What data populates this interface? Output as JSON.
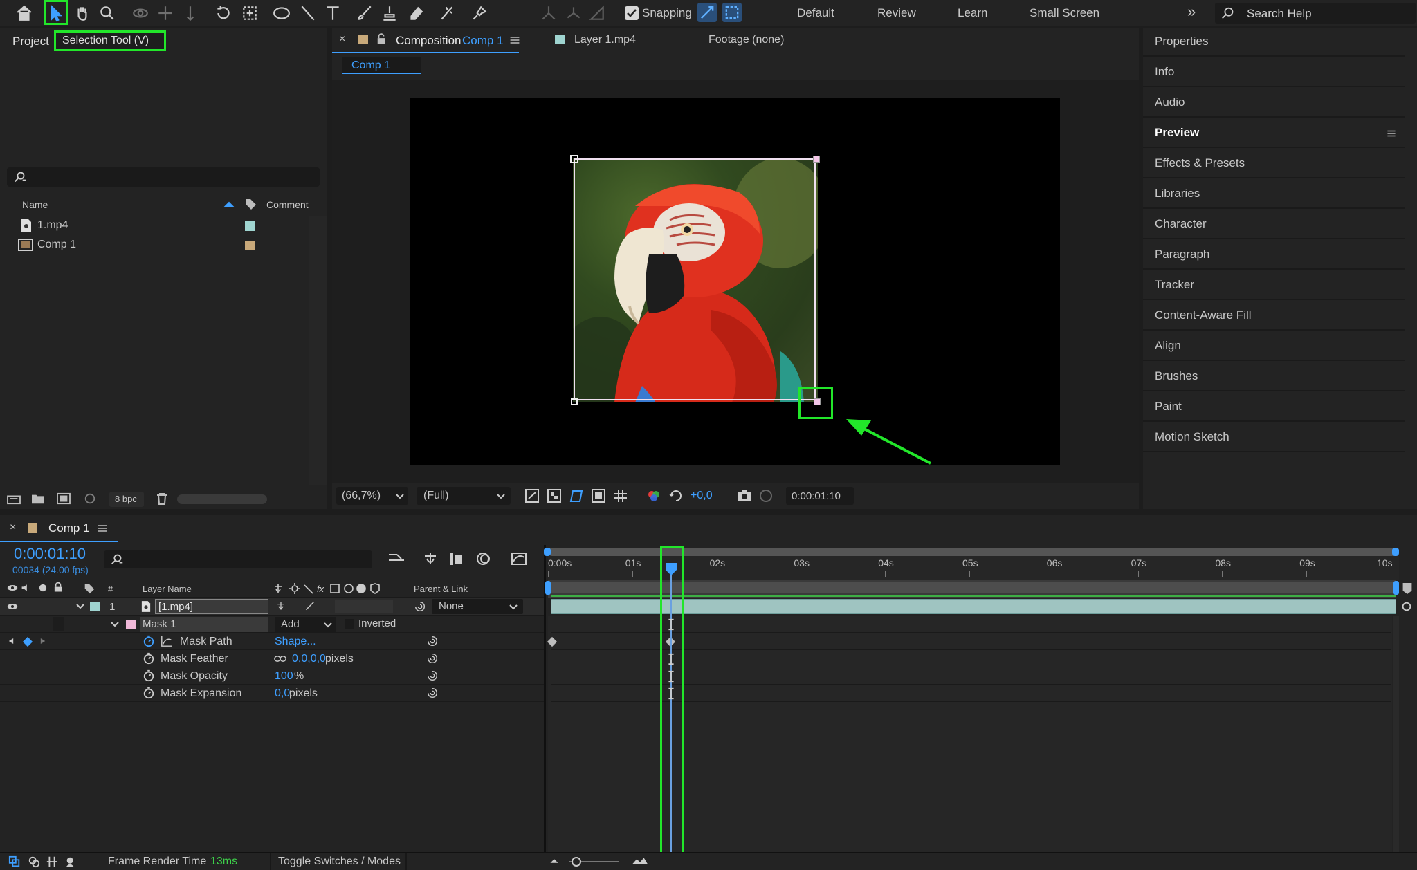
{
  "toolbar": {
    "snapping_label": "Snapping",
    "workspaces": [
      "Default",
      "Review",
      "Learn",
      "Small Screen"
    ],
    "more": "»",
    "search_placeholder": "Search Help"
  },
  "project": {
    "title": "Project",
    "tooltip": "Selection Tool (V)",
    "columns": {
      "name": "Name",
      "comment": "Comment"
    },
    "items": [
      {
        "name": "1.mp4",
        "color": "#9fd4d0"
      },
      {
        "name": "Comp 1",
        "color": "#c8a97a"
      }
    ],
    "bpc": "8 bpc"
  },
  "viewer": {
    "tab_prefix": "Composition",
    "tab_comp": "Comp 1",
    "layer_tab": "Layer 1.mp4",
    "footage_tab": "Footage (none)",
    "breadcrumb": "Comp 1",
    "zoom": "(66,7%)",
    "resolution": "(Full)",
    "exposure": "+0,0",
    "timecode": "0:00:01:10"
  },
  "right_panel": {
    "items": [
      "Properties",
      "Info",
      "Audio",
      "Preview",
      "Effects & Presets",
      "Libraries",
      "Character",
      "Paragraph",
      "Tracker",
      "Content-Aware Fill",
      "Align",
      "Brushes",
      "Paint",
      "Motion Sketch"
    ]
  },
  "timeline": {
    "tab": "Comp 1",
    "timecode": "0:00:01:10",
    "frames": "00034 (24.00 fps)",
    "headers": {
      "hash": "#",
      "layer_name": "Layer Name",
      "parent": "Parent & Link"
    },
    "layer": {
      "index": "1",
      "name": "[1.mp4]",
      "parent": "None"
    },
    "mask": {
      "name": "Mask 1",
      "mode": "Add",
      "inverted": "Inverted"
    },
    "props": [
      {
        "name": "Mask Path",
        "value": "Shape...",
        "unit": ""
      },
      {
        "name": "Mask Feather",
        "value": "0,0,0,0",
        "unit": " pixels"
      },
      {
        "name": "Mask Opacity",
        "value": "100",
        "unit": "%"
      },
      {
        "name": "Mask Expansion",
        "value": "0,0",
        "unit": " pixels"
      }
    ],
    "ruler": [
      "0:00s",
      "01s",
      "02s",
      "03s",
      "04s",
      "05s",
      "06s",
      "07s",
      "08s",
      "09s",
      "10s"
    ],
    "footer": {
      "render_label": "Frame Render Time",
      "render_value": "13ms",
      "toggle": "Toggle Switches / Modes"
    }
  },
  "colors": {
    "accent": "#3e9fff",
    "highlight": "#22e62a",
    "layer_bar": "#9fc4c1"
  }
}
